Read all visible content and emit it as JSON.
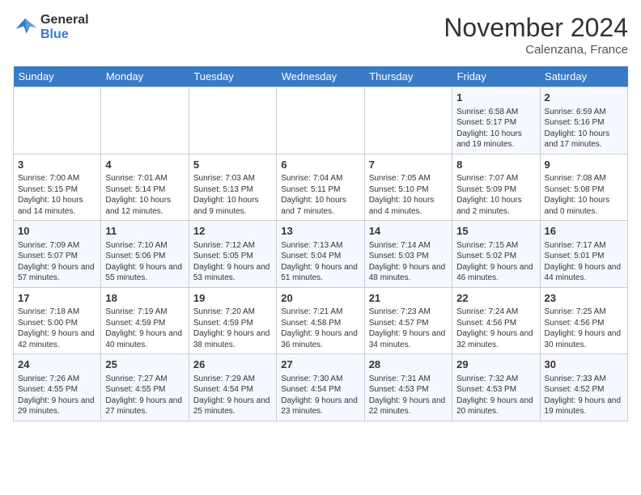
{
  "header": {
    "logo_line1": "General",
    "logo_line2": "Blue",
    "month_title": "November 2024",
    "location": "Calenzana, France"
  },
  "days_of_week": [
    "Sunday",
    "Monday",
    "Tuesday",
    "Wednesday",
    "Thursday",
    "Friday",
    "Saturday"
  ],
  "weeks": [
    [
      {
        "day": "",
        "info": ""
      },
      {
        "day": "",
        "info": ""
      },
      {
        "day": "",
        "info": ""
      },
      {
        "day": "",
        "info": ""
      },
      {
        "day": "",
        "info": ""
      },
      {
        "day": "1",
        "info": "Sunrise: 6:58 AM\nSunset: 5:17 PM\nDaylight: 10 hours\nand 19 minutes."
      },
      {
        "day": "2",
        "info": "Sunrise: 6:59 AM\nSunset: 5:16 PM\nDaylight: 10 hours\nand 17 minutes."
      }
    ],
    [
      {
        "day": "3",
        "info": "Sunrise: 7:00 AM\nSunset: 5:15 PM\nDaylight: 10 hours\nand 14 minutes."
      },
      {
        "day": "4",
        "info": "Sunrise: 7:01 AM\nSunset: 5:14 PM\nDaylight: 10 hours\nand 12 minutes."
      },
      {
        "day": "5",
        "info": "Sunrise: 7:03 AM\nSunset: 5:13 PM\nDaylight: 10 hours\nand 9 minutes."
      },
      {
        "day": "6",
        "info": "Sunrise: 7:04 AM\nSunset: 5:11 PM\nDaylight: 10 hours\nand 7 minutes."
      },
      {
        "day": "7",
        "info": "Sunrise: 7:05 AM\nSunset: 5:10 PM\nDaylight: 10 hours\nand 4 minutes."
      },
      {
        "day": "8",
        "info": "Sunrise: 7:07 AM\nSunset: 5:09 PM\nDaylight: 10 hours\nand 2 minutes."
      },
      {
        "day": "9",
        "info": "Sunrise: 7:08 AM\nSunset: 5:08 PM\nDaylight: 10 hours\nand 0 minutes."
      }
    ],
    [
      {
        "day": "10",
        "info": "Sunrise: 7:09 AM\nSunset: 5:07 PM\nDaylight: 9 hours\nand 57 minutes."
      },
      {
        "day": "11",
        "info": "Sunrise: 7:10 AM\nSunset: 5:06 PM\nDaylight: 9 hours\nand 55 minutes."
      },
      {
        "day": "12",
        "info": "Sunrise: 7:12 AM\nSunset: 5:05 PM\nDaylight: 9 hours\nand 53 minutes."
      },
      {
        "day": "13",
        "info": "Sunrise: 7:13 AM\nSunset: 5:04 PM\nDaylight: 9 hours\nand 51 minutes."
      },
      {
        "day": "14",
        "info": "Sunrise: 7:14 AM\nSunset: 5:03 PM\nDaylight: 9 hours\nand 48 minutes."
      },
      {
        "day": "15",
        "info": "Sunrise: 7:15 AM\nSunset: 5:02 PM\nDaylight: 9 hours\nand 46 minutes."
      },
      {
        "day": "16",
        "info": "Sunrise: 7:17 AM\nSunset: 5:01 PM\nDaylight: 9 hours\nand 44 minutes."
      }
    ],
    [
      {
        "day": "17",
        "info": "Sunrise: 7:18 AM\nSunset: 5:00 PM\nDaylight: 9 hours\nand 42 minutes."
      },
      {
        "day": "18",
        "info": "Sunrise: 7:19 AM\nSunset: 4:59 PM\nDaylight: 9 hours\nand 40 minutes."
      },
      {
        "day": "19",
        "info": "Sunrise: 7:20 AM\nSunset: 4:59 PM\nDaylight: 9 hours\nand 38 minutes."
      },
      {
        "day": "20",
        "info": "Sunrise: 7:21 AM\nSunset: 4:58 PM\nDaylight: 9 hours\nand 36 minutes."
      },
      {
        "day": "21",
        "info": "Sunrise: 7:23 AM\nSunset: 4:57 PM\nDaylight: 9 hours\nand 34 minutes."
      },
      {
        "day": "22",
        "info": "Sunrise: 7:24 AM\nSunset: 4:56 PM\nDaylight: 9 hours\nand 32 minutes."
      },
      {
        "day": "23",
        "info": "Sunrise: 7:25 AM\nSunset: 4:56 PM\nDaylight: 9 hours\nand 30 minutes."
      }
    ],
    [
      {
        "day": "24",
        "info": "Sunrise: 7:26 AM\nSunset: 4:55 PM\nDaylight: 9 hours\nand 29 minutes."
      },
      {
        "day": "25",
        "info": "Sunrise: 7:27 AM\nSunset: 4:55 PM\nDaylight: 9 hours\nand 27 minutes."
      },
      {
        "day": "26",
        "info": "Sunrise: 7:29 AM\nSunset: 4:54 PM\nDaylight: 9 hours\nand 25 minutes."
      },
      {
        "day": "27",
        "info": "Sunrise: 7:30 AM\nSunset: 4:54 PM\nDaylight: 9 hours\nand 23 minutes."
      },
      {
        "day": "28",
        "info": "Sunrise: 7:31 AM\nSunset: 4:53 PM\nDaylight: 9 hours\nand 22 minutes."
      },
      {
        "day": "29",
        "info": "Sunrise: 7:32 AM\nSunset: 4:53 PM\nDaylight: 9 hours\nand 20 minutes."
      },
      {
        "day": "30",
        "info": "Sunrise: 7:33 AM\nSunset: 4:52 PM\nDaylight: 9 hours\nand 19 minutes."
      }
    ]
  ]
}
